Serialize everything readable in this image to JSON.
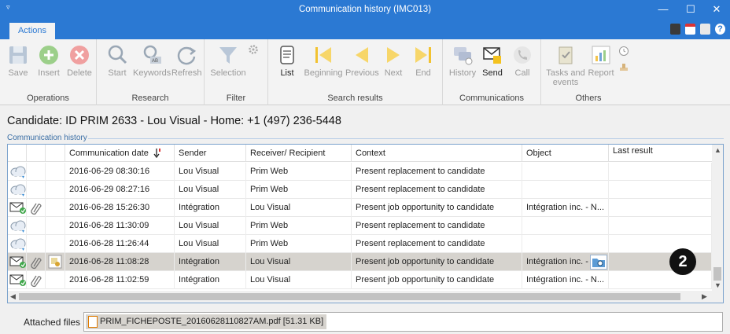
{
  "window": {
    "title": "Communication history (IMC013)",
    "sys_glyph": "▿",
    "minimize": "—",
    "maximize": "☐",
    "close": "✕"
  },
  "ribbon": {
    "tab": "Actions",
    "groups": {
      "operations": {
        "label": "Operations",
        "save": "Save",
        "insert": "Insert",
        "delete": "Delete"
      },
      "research": {
        "label": "Research",
        "start": "Start",
        "keywords": "Keywords",
        "refresh": "Refresh"
      },
      "filter": {
        "label": "Filter",
        "selection": "Selection"
      },
      "search_results": {
        "label": "Search results",
        "list": "List",
        "beginning": "Beginning",
        "previous": "Previous",
        "next": "Next",
        "end": "End"
      },
      "communications": {
        "label": "Communications",
        "history": "History",
        "send": "Send",
        "call": "Call"
      },
      "others": {
        "label": "Others",
        "tasks": "Tasks and events",
        "report": "Report"
      }
    }
  },
  "candidate_line": "Candidate: ID PRIM 2633 - Lou Visual - Home: +1 (497) 236-5448",
  "section_label": "Communication history",
  "table": {
    "columns": [
      "Communication date",
      "Sender",
      "Receiver/ Recipient",
      "Context",
      "Object",
      "Last result"
    ],
    "rows": [
      {
        "icon": "cloud",
        "clip": false,
        "date": "2016-06-29 08:30:16",
        "sender": "Lou Visual",
        "receiver": "Prim Web",
        "context": "Present replacement to candidate",
        "object": ""
      },
      {
        "icon": "cloud",
        "clip": false,
        "date": "2016-06-29 08:27:16",
        "sender": "Lou Visual",
        "receiver": "Prim Web",
        "context": "Present replacement to candidate",
        "object": ""
      },
      {
        "icon": "mail",
        "clip": true,
        "date": "2016-06-28 15:26:30",
        "sender": "Intégration",
        "receiver": "Lou Visual",
        "context": "Present job opportunity to candidate",
        "object": "Intégration inc. - N..."
      },
      {
        "icon": "cloud",
        "clip": false,
        "date": "2016-06-28 11:30:09",
        "sender": "Lou Visual",
        "receiver": "Prim Web",
        "context": "Present replacement to candidate",
        "object": ""
      },
      {
        "icon": "cloud",
        "clip": false,
        "date": "2016-06-28 11:26:44",
        "sender": "Lou Visual",
        "receiver": "Prim Web",
        "context": "Present replacement to candidate",
        "object": ""
      },
      {
        "icon": "mail",
        "clip": true,
        "date": "2016-06-28 11:08:28",
        "sender": "Intégration",
        "receiver": "Lou Visual",
        "context": "Present job opportunity to candidate",
        "object": "Intégration inc. - N"
      },
      {
        "icon": "mail",
        "clip": true,
        "date": "2016-06-28 11:02:59",
        "sender": "Intégration",
        "receiver": "Lou Visual",
        "context": "Present job opportunity to candidate",
        "object": "Intégration inc. - N..."
      }
    ],
    "selected_row_index": 5
  },
  "badge": "2",
  "attached": {
    "label": "Attached files",
    "file": "PRIM_FICHEPOSTE_20160628110827AM.pdf [51.31 KB]"
  },
  "colors": {
    "title_bar": "#2b79d3",
    "selected_row": "#d6d3ce",
    "grid_border": "#7aa2cc"
  }
}
